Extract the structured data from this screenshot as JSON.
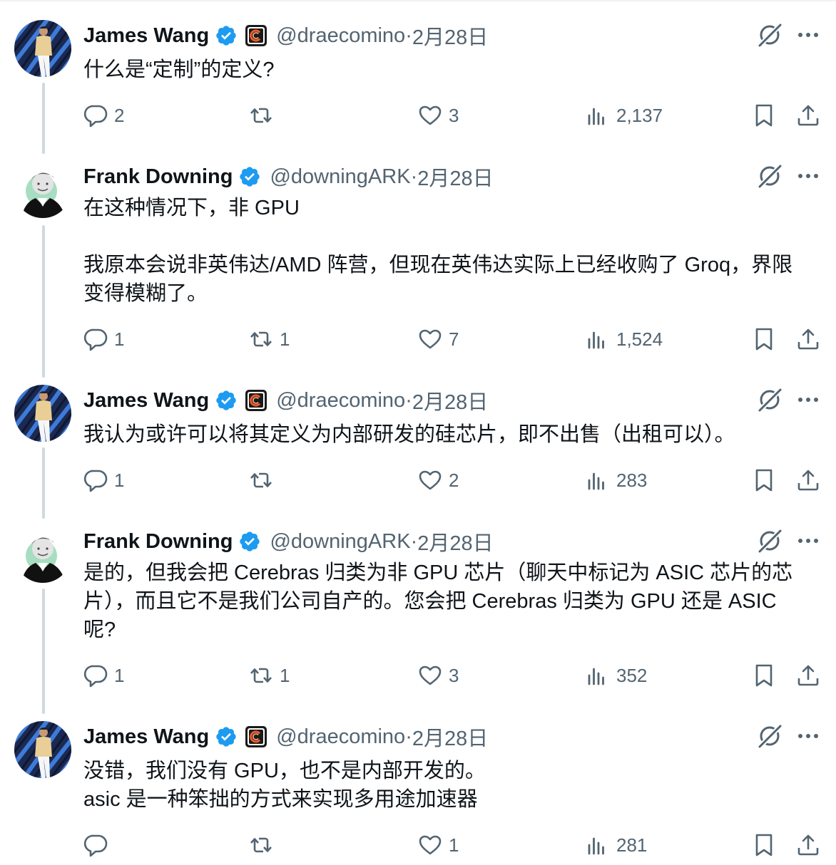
{
  "tweets": [
    {
      "author": {
        "name": "James Wang",
        "handle": "@draecomino",
        "verified": true,
        "affiliate_badge": "cerebras-logo",
        "avatar": "james-avatar"
      },
      "date": "2月28日",
      "text": "什么是“定制”的定义?",
      "stats": {
        "replies": "2",
        "retweets": "",
        "likes": "3",
        "views": "2,137"
      }
    },
    {
      "author": {
        "name": "Frank Downing",
        "handle": "@downingARK",
        "verified": true,
        "affiliate_badge": "",
        "avatar": "frank-avatar"
      },
      "date": "2月28日",
      "text": "在这种情况下，非 GPU\n\n我原本会说非英伟达/AMD 阵营，但现在英伟达实际上已经收购了 Groq，界限\n变得模糊了。",
      "stats": {
        "replies": "1",
        "retweets": "1",
        "likes": "7",
        "views": "1,524"
      }
    },
    {
      "author": {
        "name": "James Wang",
        "handle": "@draecomino",
        "verified": true,
        "affiliate_badge": "cerebras-logo",
        "avatar": "james-avatar"
      },
      "date": "2月28日",
      "text": "我认为或许可以将其定义为内部研发的硅芯片，即不出售（出租可以）。",
      "stats": {
        "replies": "1",
        "retweets": "",
        "likes": "2",
        "views": "283"
      }
    },
    {
      "author": {
        "name": "Frank Downing",
        "handle": "@downingARK",
        "verified": true,
        "affiliate_badge": "",
        "avatar": "frank-avatar"
      },
      "date": "2月28日",
      "text": "是的，但我会把 Cerebras 归类为非 GPU 芯片（聊天中标记为 ASIC 芯片的芯\n片），而且它不是我们公司自产的。您会把 Cerebras 归类为 GPU 还是 ASIC\n呢?",
      "stats": {
        "replies": "1",
        "retweets": "1",
        "likes": "3",
        "views": "352"
      }
    },
    {
      "author": {
        "name": "James Wang",
        "handle": "@draecomino",
        "verified": true,
        "affiliate_badge": "cerebras-logo",
        "avatar": "james-avatar"
      },
      "date": "2月28日",
      "text": "没错，我们没有 GPU，也不是内部开发的。\nasic 是一种笨拙的方式来实现多用途加速器",
      "stats": {
        "replies": "",
        "retweets": "",
        "likes": "1",
        "views": "281"
      }
    }
  ],
  "separator": " · ",
  "colors": {
    "verified_blue": "#1d9bf0",
    "text": "#0f1419",
    "secondary": "#536471",
    "thread_line": "#cfd9de"
  },
  "icons": [
    "verified-badge-icon",
    "grok-icon",
    "more-icon",
    "reply-icon",
    "retweet-icon",
    "like-icon",
    "views-icon",
    "bookmark-icon",
    "share-icon"
  ]
}
